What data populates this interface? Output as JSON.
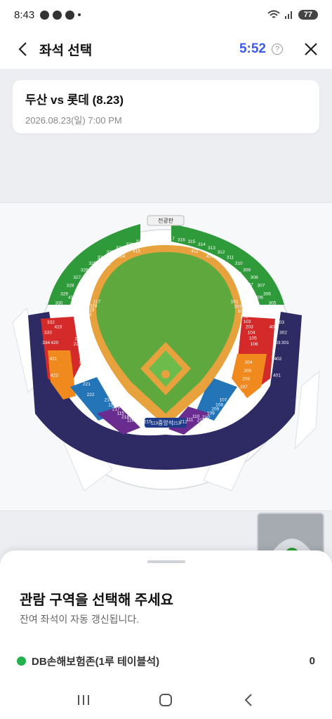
{
  "status_bar": {
    "time": "8:43",
    "battery": "77"
  },
  "header": {
    "title": "좌석 선택",
    "timer": "5:52",
    "help": "?"
  },
  "match": {
    "title": "두산 vs 롯데 (8.23)",
    "datetime": "2026.08.23(일) 7:00 PM"
  },
  "map": {
    "top_label": "전광판",
    "home_label": "중앙석",
    "sections": {
      "green_left": [
        "415",
        "414",
        "413",
        "412",
        "416",
        "417",
        "418",
        "419",
        "420",
        "421",
        "422"
      ],
      "green_right": [
        "411",
        "410",
        "409",
        "408",
        "407",
        "406",
        "405",
        "404",
        "403",
        "402",
        "401"
      ],
      "red_left": [
        "226",
        "122",
        "225",
        "121",
        "224",
        "120",
        "223",
        "119",
        "118",
        "117"
      ],
      "orange_left": [
        "222",
        "221",
        "220",
        "210"
      ],
      "red_right": [
        "101",
        "201",
        "102",
        "202",
        "103",
        "203",
        "104",
        "105",
        "106"
      ],
      "orange_right": [
        "204",
        "205",
        "206",
        "207",
        "208"
      ],
      "blue_left": [
        "116",
        "218",
        "115",
        "217",
        "114",
        "216"
      ],
      "blue_right": [
        "107",
        "108",
        "209",
        "109",
        "210",
        "211"
      ],
      "purple_left": [
        "113",
        "215",
        "112",
        "214"
      ],
      "purple_right": [
        "110",
        "111",
        "212",
        "213"
      ],
      "navy": [
        "334",
        "333",
        "332",
        "331",
        "330",
        "329",
        "328",
        "327",
        "326",
        "325",
        "324",
        "323",
        "322",
        "321",
        "320",
        "319",
        "318",
        "317",
        "316",
        "315",
        "314",
        "313",
        "312",
        "311",
        "310",
        "309",
        "308",
        "307",
        "306",
        "305",
        "304",
        "303",
        "302",
        "301"
      ]
    }
  },
  "sheet": {
    "title": "관람 구역을 선택해 주세요",
    "subtitle": "잔여 좌석이 자동 갱신됩니다.",
    "zones": [
      {
        "name": "DB손해보험존(1루 테이블석)",
        "count": "0",
        "color": "#22b14c"
      }
    ]
  }
}
